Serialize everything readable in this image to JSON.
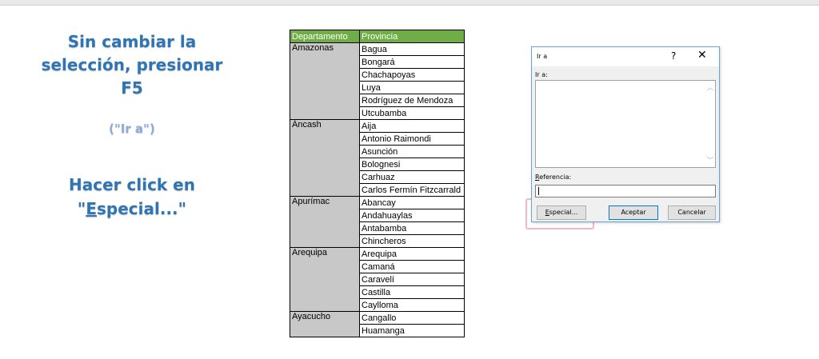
{
  "instructions": {
    "step1_line1": "Sin cambiar la",
    "step1_line2": "selección, presionar",
    "step1_line3": "F5",
    "step1_note": "(\"Ir a\")",
    "step2_line1": "Hacer click en",
    "step2_line2_before": "\"",
    "step2_line2_underlined": "E",
    "step2_line2_after": "special...\""
  },
  "table": {
    "headers": [
      "Departamento",
      "Provincia"
    ],
    "groups": [
      {
        "departamento": "Amazonas",
        "provincias": [
          "Bagua",
          "Bongará",
          "Chachapoyas",
          "Luya",
          "Rodríguez de Mendoza",
          "Utcubamba"
        ]
      },
      {
        "departamento": "Áncash",
        "provincias": [
          "Aija",
          "Antonio Raimondi",
          "Asunción",
          "Bolognesi",
          "Carhuaz",
          "Carlos Fermín Fitzcarrald"
        ]
      },
      {
        "departamento": "Apurímac",
        "provincias": [
          "Abancay",
          "Andahuaylas",
          "Antabamba",
          "Chincheros"
        ]
      },
      {
        "departamento": "Arequipa",
        "provincias": [
          "Arequipa",
          "Camaná",
          "Caravelí",
          "Castilla",
          "Caylloma"
        ]
      },
      {
        "departamento": "Ayacucho",
        "provincias": [
          "Cangallo",
          "Huamanga"
        ]
      }
    ],
    "header_color": "#70ad47",
    "dep_fill_color": "#c8c8c8"
  },
  "dialog": {
    "title": "Ir a",
    "help_label": "?",
    "close_label": "✕",
    "ira_label": "Ir a:",
    "referencia_label_underlined": "R",
    "referencia_label_rest": "eferencia:",
    "referencia_value": "",
    "especial_underlined": "E",
    "especial_rest": "special...",
    "aceptar_label": "Aceptar",
    "cancelar_label": "Cancelar",
    "scroll_up_icon": "chevron-up-icon",
    "scroll_down_icon": "chevron-down-icon"
  },
  "accent_color": "#2e75b6",
  "highlight_color": "#f4b8bf"
}
